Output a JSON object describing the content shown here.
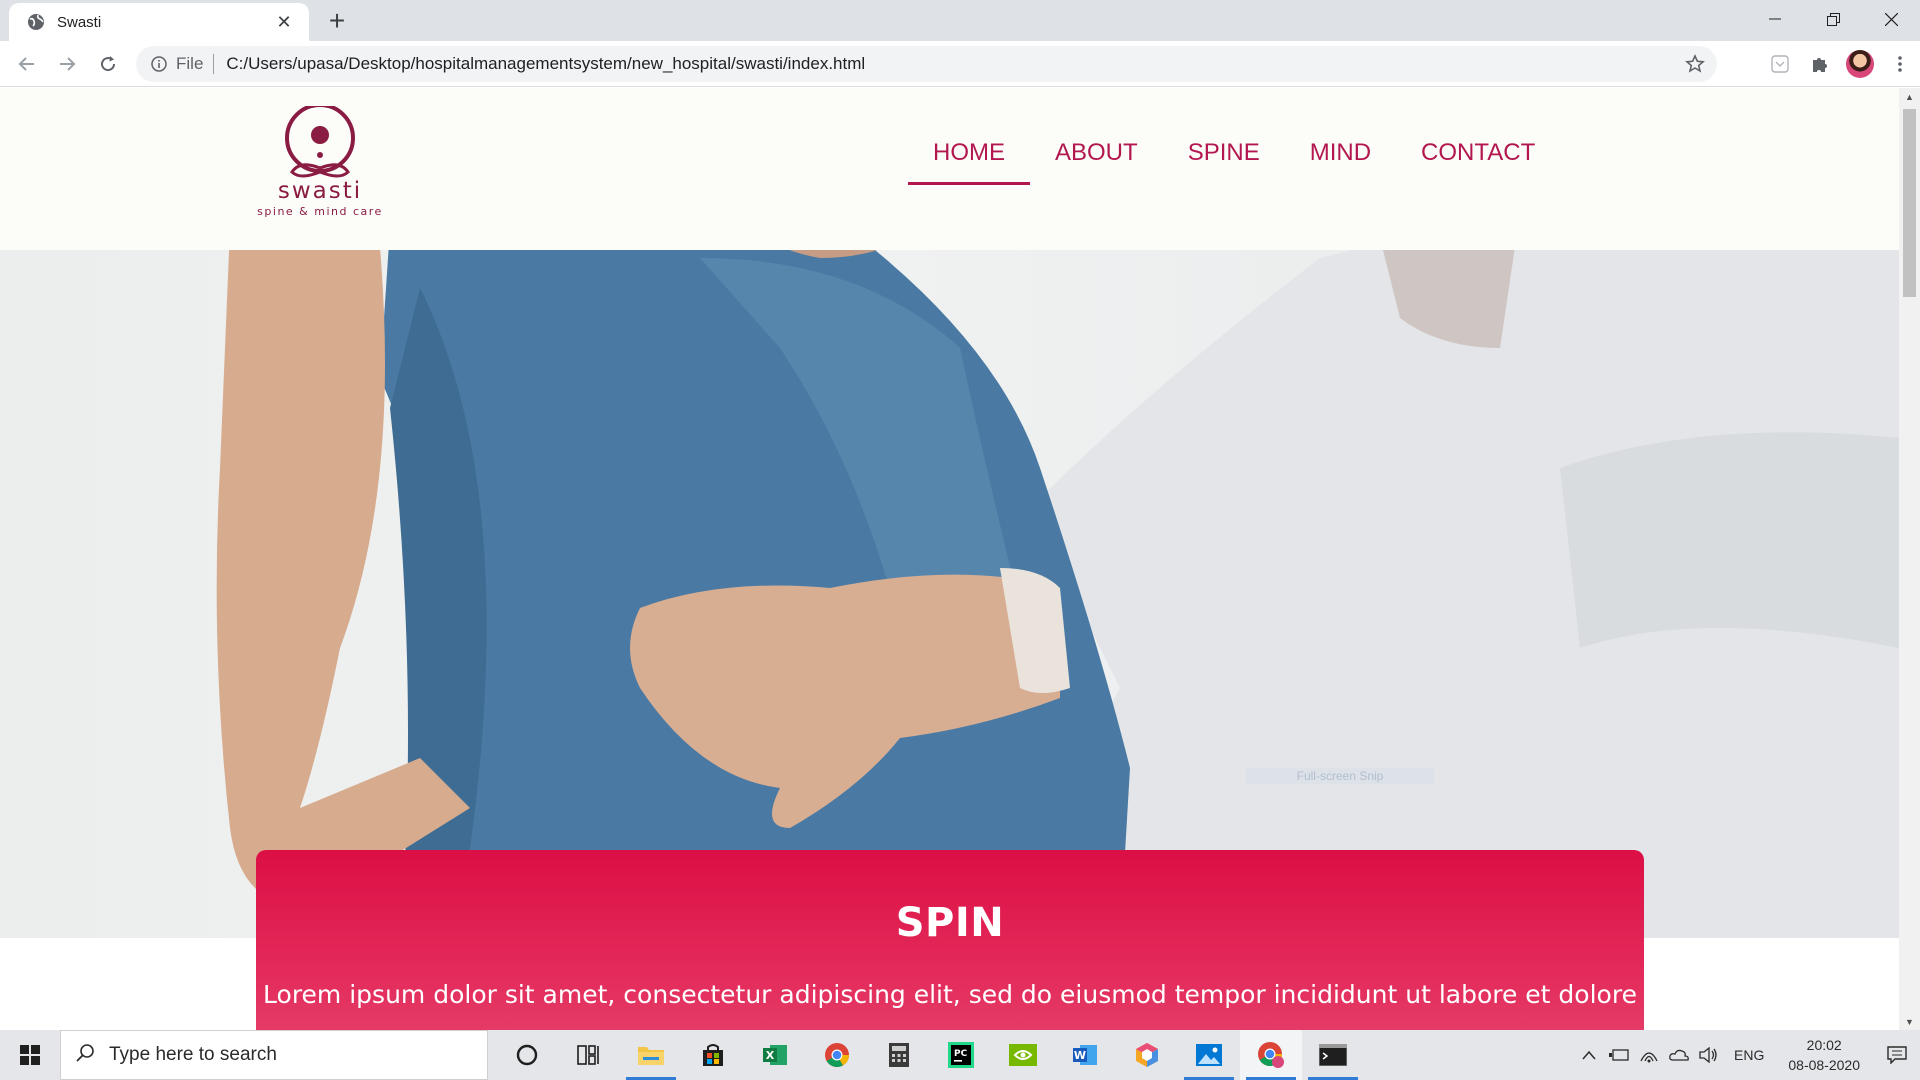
{
  "browser": {
    "tab_title": "Swasti",
    "new_tab": "+",
    "scheme_label": "File",
    "url": "C:/Users/upasa/Desktop/hospitalmanagementsystem/new_hospital/swasti/index.html"
  },
  "site": {
    "logo": {
      "name": "swasti",
      "tagline": "spine & mind care"
    },
    "nav": [
      {
        "label": "HOME",
        "active": true
      },
      {
        "label": "ABOUT"
      },
      {
        "label": "SPINE"
      },
      {
        "label": "MIND"
      },
      {
        "label": "CONTACT"
      }
    ],
    "card": {
      "title": "SPIN",
      "text": "Lorem ipsum dolor sit amet, consectetur adipiscing elit, sed do eiusmod tempor incididunt ut labore et dolore"
    },
    "snip_overlay": "Full-screen Snip",
    "colors": {
      "brand": "#b3174f",
      "card_top": "#dc0f45",
      "card_bottom": "#e6406a"
    }
  },
  "taskbar": {
    "search_placeholder": "Type here to search",
    "language": "ENG",
    "time": "20:02",
    "date": "08-08-2020",
    "apps": [
      "task-view",
      "file-explorer",
      "microsoft-store",
      "excel",
      "chrome",
      "calculator",
      "pycharm",
      "nvidia",
      "word",
      "cube-app",
      "photos",
      "chrome-profile",
      "terminal"
    ]
  }
}
